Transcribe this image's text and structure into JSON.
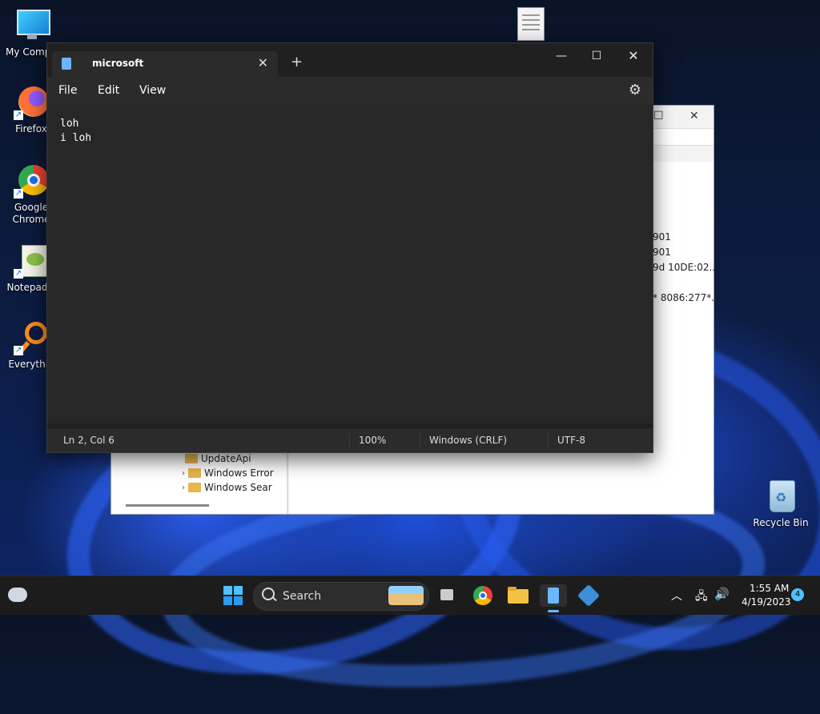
{
  "desktop": {
    "icons": [
      {
        "label": "My Compu",
        "icon": "computer-icon"
      },
      {
        "label": "Firefox",
        "icon": "firefox-icon"
      },
      {
        "label": "Google Chrome",
        "icon": "chrome-icon"
      },
      {
        "label": "Notepad+",
        "icon": "notepad-plus-plus-icon"
      },
      {
        "label": "Everythin",
        "icon": "everything-search-icon"
      },
      {
        "label": "Recycle Bin",
        "icon": "recycle-bin-icon"
      }
    ]
  },
  "background_window": {
    "values": [
      "901",
      "901",
      "9d 10DE:02...",
      "* 8086:277*..."
    ],
    "tree_items": [
      "UpdateApi",
      "Windows Error",
      "Windows Sear"
    ]
  },
  "notepad": {
    "tab_title": "microsoft",
    "menu": {
      "file": "File",
      "edit": "Edit",
      "view": "View"
    },
    "content": "loh\ni loh",
    "status": {
      "position": "Ln 2, Col 6",
      "zoom": "100%",
      "line_ending": "Windows (CRLF)",
      "encoding": "UTF-8"
    }
  },
  "taskbar": {
    "search_label": "Search",
    "time": "1:55 AM",
    "date": "4/19/2023",
    "notification_count": "4"
  },
  "colors": {
    "accent": "#1a73e8",
    "notepad_bg": "#272727",
    "taskbar_bg": "#1c1c1c"
  }
}
